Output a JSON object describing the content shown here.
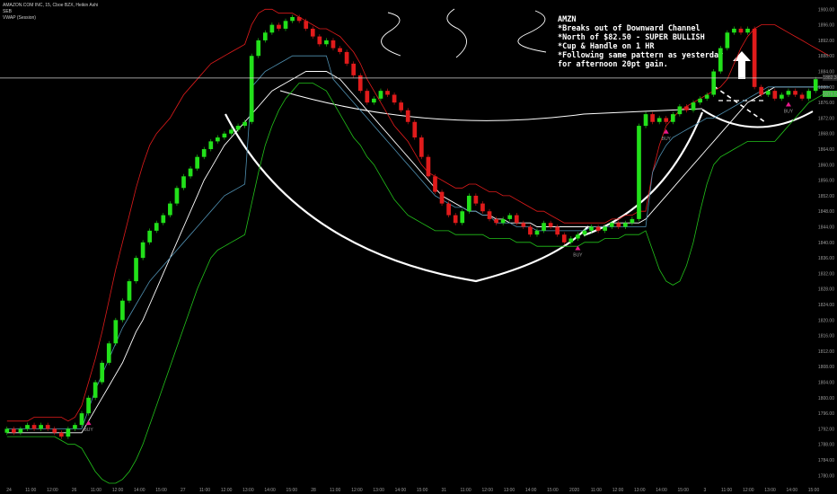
{
  "header": {
    "title": "AMAZON.COM INC, 15, Cboe BZX, Heikin Ashi",
    "study1": "SEB",
    "study2": "VWAP (Session)"
  },
  "annotation": {
    "lines": [
      "AMZN",
      "*Breaks out of Downward Channel",
      "*North of $82.50 - SUPER BULLISH",
      "*Cup & Handle on 1 HR",
      "*Following same pattern as yesterday",
      "for afternoon 20pt gain."
    ]
  },
  "colors": {
    "up": "#22e01a",
    "down": "#e01b1b",
    "upper_band": "#e01b1b",
    "lower_band": "#22c21a",
    "ma": "#ffffff",
    "vwap": "#4f8fb0",
    "buy_marker": "#e8198b",
    "price_tag": "#3bbd3b"
  },
  "chart_data": {
    "type": "candlestick",
    "title": "AMAZON.COM INC, 15, Cboe BZX, Heikin Ashi",
    "x_ticks": [
      "24",
      "11:00",
      "12:00",
      "26",
      "11:00",
      "12:00",
      "14:00",
      "15:00",
      "27",
      "11:00",
      "12:00",
      "13:00",
      "14:00",
      "15:00",
      "28",
      "11:00",
      "12:00",
      "13:00",
      "14:00",
      "15:00",
      "31",
      "11:00",
      "12:00",
      "13:00",
      "14:00",
      "15:00",
      "2020",
      "11:00",
      "12:00",
      "13:00",
      "14:00",
      "15:00",
      "3",
      "11:00",
      "12:00",
      "13:00",
      "14:00",
      "15:00"
    ],
    "y_ticks": [
      "1900.00",
      "1896.00",
      "1892.00",
      "1888.00",
      "1884.00",
      "1880.00",
      "1876.00",
      "1872.00",
      "1868.00",
      "1864.00",
      "1860.00",
      "1856.00",
      "1852.00",
      "1848.00",
      "1844.00",
      "1840.00",
      "1836.00",
      "1832.00",
      "1828.00",
      "1824.00",
      "1820.00",
      "1816.00",
      "1812.00",
      "1808.00",
      "1804.00",
      "1800.00",
      "1796.00",
      "1792.00",
      "1788.00",
      "1784.00",
      "1780.00"
    ],
    "y_range": [
      1778,
      1901
    ],
    "price_labels": [
      "1882.3",
      "1879.5"
    ],
    "horizontal_line": 1882.3,
    "buy_labels": [
      "BUY",
      "BUY",
      "BUY",
      "BUY"
    ],
    "candles": [
      [
        1791,
        1792
      ],
      [
        1792,
        1791
      ],
      [
        1791,
        1792
      ],
      [
        1792,
        1793
      ],
      [
        1793,
        1792
      ],
      [
        1792,
        1793
      ],
      [
        1793,
        1792
      ],
      [
        1792,
        1791
      ],
      [
        1791,
        1790
      ],
      [
        1790,
        1792
      ],
      [
        1792,
        1793
      ],
      [
        1793,
        1796
      ],
      [
        1796,
        1800
      ],
      [
        1800,
        1804
      ],
      [
        1804,
        1809
      ],
      [
        1809,
        1814
      ],
      [
        1814,
        1820
      ],
      [
        1820,
        1825
      ],
      [
        1825,
        1830
      ],
      [
        1830,
        1836
      ],
      [
        1836,
        1840
      ],
      [
        1840,
        1843
      ],
      [
        1843,
        1845
      ],
      [
        1845,
        1847
      ],
      [
        1847,
        1850
      ],
      [
        1850,
        1854
      ],
      [
        1854,
        1857
      ],
      [
        1857,
        1859
      ],
      [
        1859,
        1862
      ],
      [
        1862,
        1864
      ],
      [
        1864,
        1866
      ],
      [
        1866,
        1867
      ],
      [
        1867,
        1868
      ],
      [
        1868,
        1869
      ],
      [
        1869,
        1870
      ],
      [
        1870,
        1871
      ],
      [
        1871,
        1888
      ],
      [
        1888,
        1892
      ],
      [
        1892,
        1894
      ],
      [
        1894,
        1896
      ],
      [
        1896,
        1895
      ],
      [
        1895,
        1897
      ],
      [
        1897,
        1898
      ],
      [
        1898,
        1897
      ],
      [
        1897,
        1895
      ],
      [
        1895,
        1893
      ],
      [
        1893,
        1891
      ],
      [
        1891,
        1892
      ],
      [
        1892,
        1890
      ],
      [
        1890,
        1889
      ],
      [
        1889,
        1886
      ],
      [
        1886,
        1883
      ],
      [
        1883,
        1879
      ],
      [
        1879,
        1876
      ],
      [
        1876,
        1877
      ],
      [
        1877,
        1879
      ],
      [
        1879,
        1878
      ],
      [
        1878,
        1876
      ],
      [
        1876,
        1874
      ],
      [
        1874,
        1871
      ],
      [
        1871,
        1867
      ],
      [
        1867,
        1862
      ],
      [
        1862,
        1857
      ],
      [
        1857,
        1853
      ],
      [
        1853,
        1850
      ],
      [
        1850,
        1847
      ],
      [
        1847,
        1845
      ],
      [
        1845,
        1848
      ],
      [
        1848,
        1852
      ],
      [
        1852,
        1850
      ],
      [
        1850,
        1848
      ],
      [
        1848,
        1846
      ],
      [
        1846,
        1845
      ],
      [
        1845,
        1846
      ],
      [
        1846,
        1847
      ],
      [
        1847,
        1845
      ],
      [
        1845,
        1844
      ],
      [
        1844,
        1842
      ],
      [
        1842,
        1843
      ],
      [
        1843,
        1845
      ],
      [
        1845,
        1844
      ],
      [
        1844,
        1842
      ],
      [
        1842,
        1840
      ],
      [
        1840,
        1841
      ],
      [
        1841,
        1842
      ],
      [
        1842,
        1843
      ],
      [
        1843,
        1844
      ],
      [
        1844,
        1843
      ],
      [
        1843,
        1844
      ],
      [
        1844,
        1845
      ],
      [
        1845,
        1844
      ],
      [
        1844,
        1845
      ],
      [
        1845,
        1846
      ],
      [
        1846,
        1870
      ],
      [
        1870,
        1873
      ],
      [
        1873,
        1871
      ],
      [
        1871,
        1872
      ],
      [
        1872,
        1871
      ],
      [
        1871,
        1873
      ],
      [
        1873,
        1875
      ],
      [
        1875,
        1874
      ],
      [
        1874,
        1876
      ],
      [
        1876,
        1877
      ],
      [
        1877,
        1878
      ],
      [
        1878,
        1884
      ],
      [
        1884,
        1890
      ],
      [
        1890,
        1894
      ],
      [
        1894,
        1895
      ],
      [
        1895,
        1894
      ],
      [
        1894,
        1895
      ],
      [
        1895,
        1880
      ],
      [
        1880,
        1878
      ],
      [
        1878,
        1879
      ],
      [
        1879,
        1877
      ],
      [
        1877,
        1878
      ],
      [
        1878,
        1879
      ],
      [
        1879,
        1878
      ],
      [
        1878,
        1877
      ],
      [
        1877,
        1879
      ],
      [
        1879,
        1882
      ]
    ],
    "buy_signals": [
      12,
      84,
      97,
      115
    ],
    "series": [
      {
        "role": "upper_band",
        "values": [
          1794,
          1794,
          1794,
          1794,
          1795,
          1795,
          1795,
          1795,
          1795,
          1794,
          1795,
          1798,
          1804,
          1810,
          1817,
          1825,
          1833,
          1840,
          1847,
          1854,
          1860,
          1865,
          1868,
          1870,
          1872,
          1875,
          1878,
          1880,
          1882,
          1884,
          1886,
          1887,
          1888,
          1889,
          1890,
          1891,
          1896,
          1899,
          1900,
          1900,
          1899,
          1899,
          1899,
          1898,
          1897,
          1896,
          1895,
          1895,
          1894,
          1893,
          1891,
          1889,
          1886,
          1882,
          1879,
          1876,
          1873,
          1870,
          1868,
          1866,
          1863,
          1860,
          1858,
          1857,
          1856,
          1855,
          1854,
          1854,
          1855,
          1855,
          1854,
          1853,
          1853,
          1852,
          1852,
          1851,
          1850,
          1849,
          1848,
          1848,
          1847,
          1846,
          1845,
          1845,
          1845,
          1845,
          1845,
          1845,
          1845,
          1846,
          1846,
          1847,
          1847,
          1848,
          1848,
          1858,
          1865,
          1870,
          1872,
          1874,
          1875,
          1876,
          1877,
          1878,
          1879,
          1880,
          1882,
          1886,
          1890,
          1893,
          1895,
          1896,
          1896,
          1896,
          1895,
          1894,
          1893,
          1892,
          1891,
          1890,
          1889,
          1888
        ]
      },
      {
        "role": "ma",
        "values": [
          1791,
          1791,
          1791,
          1791,
          1791,
          1791,
          1791,
          1791,
          1791,
          1791,
          1791,
          1791,
          1794,
          1797,
          1800,
          1803,
          1806,
          1809,
          1813,
          1817,
          1820,
          1824,
          1828,
          1832,
          1836,
          1840,
          1844,
          1848,
          1852,
          1856,
          1859,
          1862,
          1865,
          1867,
          1869,
          1871,
          1873,
          1875,
          1877,
          1879,
          1880,
          1881,
          1882,
          1883,
          1884,
          1884,
          1884,
          1884,
          1883,
          1882,
          1880,
          1878,
          1876,
          1874,
          1872,
          1870,
          1868,
          1866,
          1864,
          1862,
          1860,
          1858,
          1856,
          1854,
          1852,
          1851,
          1850,
          1849,
          1848,
          1848,
          1847,
          1847,
          1846,
          1846,
          1845,
          1845,
          1845,
          1845,
          1844,
          1844,
          1844,
          1844,
          1844,
          1844,
          1844,
          1844,
          1844,
          1844,
          1844,
          1845,
          1845,
          1845,
          1845,
          1845,
          1846,
          1848,
          1850,
          1852,
          1854,
          1856,
          1858,
          1860,
          1862,
          1864,
          1866,
          1868,
          1870,
          1872,
          1874,
          1876,
          1877,
          1878,
          1879,
          1880,
          1880,
          1880,
          1880,
          1880,
          1880,
          1880,
          1880,
          1880
        ]
      },
      {
        "role": "vwap",
        "values": [
          1792,
          1792,
          1792,
          1792,
          1792,
          1792,
          1792,
          1792,
          1792,
          1792,
          1792,
          1792,
          1797,
          1802,
          1806,
          1810,
          1814,
          1818,
          1821,
          1824,
          1827,
          1830,
          1832,
          1834,
          1836,
          1838,
          1840,
          1842,
          1844,
          1846,
          1848,
          1850,
          1852,
          1853,
          1854,
          1855,
          1880,
          1882,
          1884,
          1885,
          1886,
          1887,
          1888,
          1888,
          1888,
          1888,
          1888,
          1888,
          1882,
          1880,
          1878,
          1876,
          1874,
          1872,
          1870,
          1868,
          1866,
          1864,
          1862,
          1860,
          1858,
          1856,
          1854,
          1852,
          1851,
          1850,
          1849,
          1849,
          1848,
          1848,
          1847,
          1847,
          1845,
          1845,
          1845,
          1844,
          1844,
          1844,
          1843,
          1843,
          1843,
          1843,
          1843,
          1843,
          1843,
          1843,
          1844,
          1844,
          1844,
          1844,
          1844,
          1844,
          1844,
          1844,
          1844,
          1858,
          1862,
          1865,
          1867,
          1868,
          1869,
          1870,
          1871,
          1872,
          1872,
          1873,
          1874,
          1875,
          1876,
          1877,
          1878,
          1879,
          1880,
          1880,
          1880,
          1880,
          1880,
          1880,
          1880,
          1880,
          1880,
          1880
        ]
      },
      {
        "role": "lower_band",
        "values": [
          1790,
          1790,
          1790,
          1790,
          1790,
          1790,
          1790,
          1790,
          1789,
          1788,
          1788,
          1787,
          1784,
          1781,
          1779,
          1778,
          1778,
          1779,
          1781,
          1784,
          1788,
          1793,
          1798,
          1803,
          1808,
          1813,
          1818,
          1823,
          1828,
          1832,
          1836,
          1838,
          1839,
          1840,
          1841,
          1842,
          1850,
          1858,
          1865,
          1870,
          1874,
          1877,
          1879,
          1881,
          1881,
          1881,
          1880,
          1879,
          1876,
          1873,
          1870,
          1867,
          1865,
          1862,
          1860,
          1857,
          1854,
          1851,
          1849,
          1847,
          1846,
          1845,
          1844,
          1843,
          1843,
          1843,
          1842,
          1842,
          1842,
          1842,
          1842,
          1841,
          1841,
          1841,
          1841,
          1840,
          1840,
          1840,
          1839,
          1839,
          1839,
          1839,
          1839,
          1839,
          1839,
          1840,
          1840,
          1840,
          1841,
          1841,
          1841,
          1842,
          1842,
          1842,
          1843,
          1838,
          1833,
          1830,
          1829,
          1830,
          1834,
          1840,
          1848,
          1855,
          1860,
          1862,
          1863,
          1864,
          1865,
          1866,
          1866,
          1866,
          1866,
          1866,
          1868,
          1870,
          1872,
          1874,
          1876,
          1877,
          1878,
          1878
        ]
      }
    ],
    "legend": "none",
    "grid": false
  }
}
